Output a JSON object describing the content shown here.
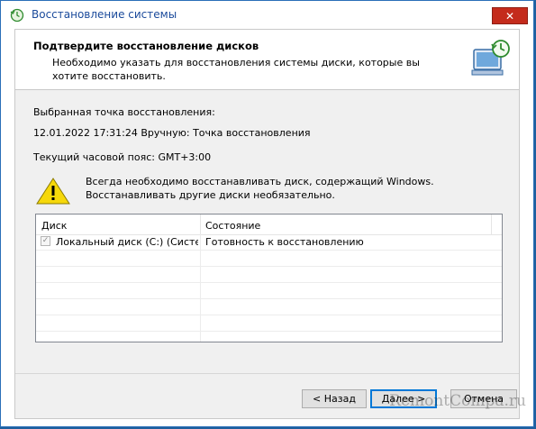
{
  "window": {
    "title": "Восстановление системы",
    "close_glyph": "✕"
  },
  "header": {
    "title": "Подтвердите восстановление дисков",
    "description": "Необходимо указать для восстановления системы диски, которые вы хотите восстановить."
  },
  "restore_point": {
    "label": "Выбранная точка восстановления:",
    "value": "12.01.2022 17:31:24 Вручную: Точка восстановления",
    "timezone": "Текущий часовой пояс: GMT+3:00"
  },
  "warning": {
    "text": "Всегда необходимо восстанавливать диск, содержащий Windows. Восстанавливать другие диски необязательно."
  },
  "table": {
    "columns": [
      "Диск",
      "Состояние"
    ],
    "sort_glyph": "^",
    "rows": [
      {
        "disk": "Локальный диск (C:) (Систе...",
        "status": "Готовность к восстановлению",
        "checked": true,
        "check_glyph": "✓"
      }
    ]
  },
  "buttons": {
    "back": "< Назад",
    "next": "Далее >",
    "cancel": "Отмена"
  },
  "watermark": "RemontCompa.ru",
  "colors": {
    "title_text": "#1a4a9b",
    "close_button": "#c42b1c",
    "warning_fill": "#f6d80a",
    "default_button_border": "#0078d7"
  },
  "icons": {
    "title": "system-restore-icon",
    "header": "monitor-restore-icon",
    "warning": "warning-triangle-icon"
  }
}
